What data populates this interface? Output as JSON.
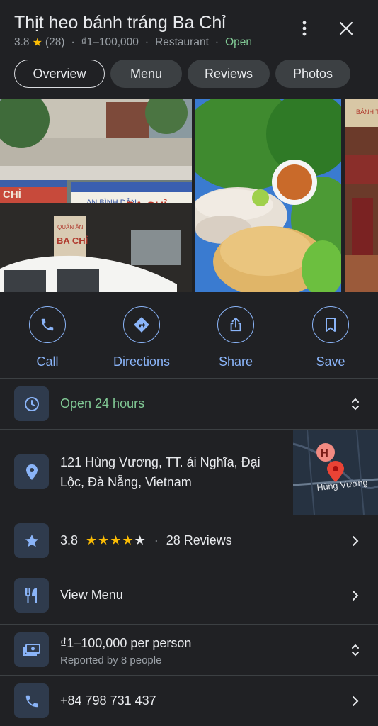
{
  "header": {
    "title": "Thịt heo bánh tráng Ba Chỉ",
    "rating": "3.8",
    "review_count": "(28)",
    "price": "₫1–100,000",
    "category": "Restaurant",
    "status": "Open"
  },
  "tabs": [
    {
      "label": "Overview",
      "active": true
    },
    {
      "label": "Menu"
    },
    {
      "label": "Reviews"
    },
    {
      "label": "Photos"
    }
  ],
  "photos": {
    "sign_left": "AN BÌNH DÂN",
    "sign_right": "BA CHỈ",
    "sign_small": "QUÁN ĂN",
    "sign_small2": "BA CHỈ",
    "sign_far_left": "CHỈ",
    "sign_third": "BÁNH TRÁ"
  },
  "actions": [
    {
      "label": "Call",
      "icon": "phone-icon"
    },
    {
      "label": "Directions",
      "icon": "directions-icon"
    },
    {
      "label": "Share",
      "icon": "share-icon"
    },
    {
      "label": "Save",
      "icon": "bookmark-icon"
    }
  ],
  "info": {
    "hours": "Open 24 hours",
    "address_line1": "121 Hùng Vương, TT. ái Nghĩa, Đại",
    "address_line2": "Lộc, Đà Nẵng, Vietnam",
    "map_label": "Hùng Vương",
    "map_marker_letter": "H",
    "rating_value": "3.8",
    "rating_sep": "·",
    "rating_reviews": "28 Reviews",
    "rating_stars": 3.8,
    "menu": "View Menu",
    "price": "₫1–100,000 per person",
    "price_sub": "Reported by 8 people",
    "phone": "+84 798 731 437"
  },
  "colors": {
    "background": "#202124",
    "accent": "#8ab4f8",
    "open": "#81c995",
    "star": "#fbbc04"
  }
}
